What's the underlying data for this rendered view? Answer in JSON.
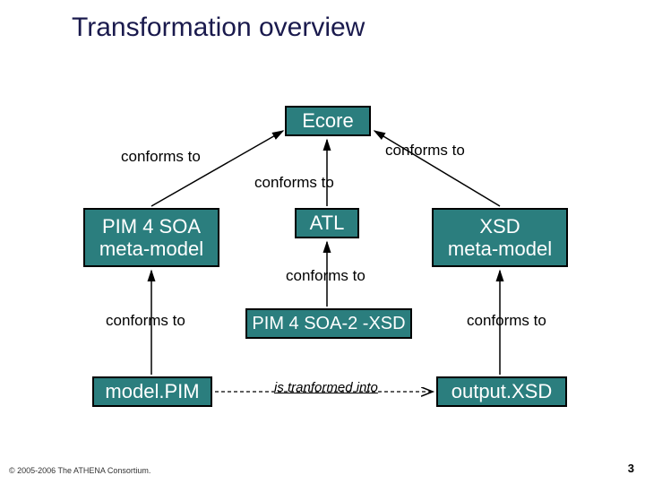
{
  "title": "Transformation overview",
  "boxes": {
    "ecore": "Ecore",
    "pim4soa_mm": "PIM 4 SOA\nmeta-model",
    "atl": "ATL",
    "xsd_mm": "XSD\nmeta-model",
    "pim4soa2xsd": "PIM 4 SOA-2 -XSD",
    "model_pim": "model.PIM",
    "output_xsd": "output.XSD"
  },
  "labels": {
    "conforms_left_top": "conforms to",
    "conforms_right_top": "conforms to",
    "conforms_center_top": "conforms to",
    "conforms_center_mid": "conforms to",
    "conforms_left_bottom": "conforms to",
    "conforms_right_bottom": "conforms to",
    "is_transformed": "is tranformed into"
  },
  "footer": "© 2005-2006 The ATHENA Consortium.",
  "pagenum": "3"
}
